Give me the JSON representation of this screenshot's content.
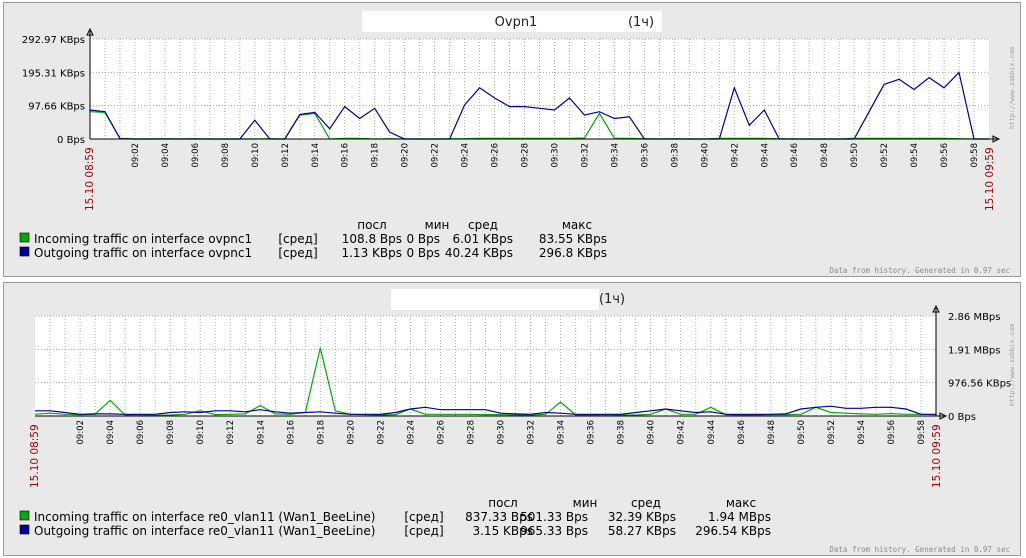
{
  "colors": {
    "incoming": "#00aa00",
    "outgoing": "#000099",
    "edge_label": "#aa0000",
    "grid": "#aaaaaa",
    "panel_bg": "#e9e9e9"
  },
  "time_labels": [
    "09:02",
    "09:04",
    "09:06",
    "09:08",
    "09:10",
    "09:12",
    "09:14",
    "09:16",
    "09:18",
    "09:20",
    "09:22",
    "09:24",
    "09:26",
    "09:28",
    "09:30",
    "09:32",
    "09:34",
    "09:36",
    "09:38",
    "09:40",
    "09:42",
    "09:44",
    "09:46",
    "09:48",
    "09:50",
    "09:52",
    "09:54",
    "09:56",
    "09:58"
  ],
  "start_label": "15.10 08:59",
  "end_label": "15.10 09:59",
  "footer_text": "Data from history. Generated in 0.97 sec",
  "watermark": "http://www.zabbix.com",
  "legend_headers": {
    "last": "посл",
    "min": "мин",
    "avg": "сред",
    "max": "макс"
  },
  "chart_data": [
    {
      "type": "line",
      "title": "Ovpn1",
      "period": "(1ч)",
      "x": [
        "08:59",
        "09:00",
        "09:01",
        "09:02",
        "09:03",
        "09:04",
        "09:05",
        "09:06",
        "09:07",
        "09:08",
        "09:09",
        "09:10",
        "09:11",
        "09:12",
        "09:13",
        "09:14",
        "09:15",
        "09:16",
        "09:17",
        "09:18",
        "09:19",
        "09:20",
        "09:21",
        "09:22",
        "09:23",
        "09:24",
        "09:25",
        "09:26",
        "09:27",
        "09:28",
        "09:29",
        "09:30",
        "09:31",
        "09:32",
        "09:33",
        "09:34",
        "09:35",
        "09:36",
        "09:37",
        "09:38",
        "09:39",
        "09:40",
        "09:41",
        "09:42",
        "09:43",
        "09:44",
        "09:45",
        "09:46",
        "09:47",
        "09:48",
        "09:49",
        "09:50",
        "09:51",
        "09:52",
        "09:53",
        "09:54",
        "09:55",
        "09:56",
        "09:57",
        "09:58",
        "09:59"
      ],
      "y_ticks": [
        "0 Bps",
        "97.66 KBps",
        "195.31 KBps",
        "292.97 KBps"
      ],
      "ylim": [
        0,
        292.97
      ],
      "y_unit": "KBps",
      "y_axis_side": "left",
      "series": [
        {
          "name": "Incoming traffic on interface ovpnc1",
          "values": [
            80,
            78,
            2,
            0,
            0,
            1,
            0,
            1,
            0,
            0,
            0,
            0,
            1,
            0,
            70,
            75,
            0,
            2,
            2,
            0,
            1,
            0,
            0,
            0,
            1,
            1,
            2,
            2,
            2,
            2,
            2,
            2,
            2,
            3,
            75,
            2,
            2,
            1,
            0,
            1,
            0,
            0,
            2,
            2,
            2,
            2,
            1,
            0,
            0,
            0,
            0,
            2,
            2,
            2,
            2,
            2,
            2,
            2,
            1,
            0,
            0
          ],
          "fn": "сред",
          "last": "108.8 Bps",
          "min": "0 Bps",
          "avg": "6.01 KBps",
          "max": "83.55 KBps"
        },
        {
          "name": "Outgoing traffic on interface ovpnc1",
          "values": [
            85,
            80,
            1,
            0,
            0,
            0,
            0,
            0,
            0,
            0,
            0,
            55,
            0,
            0,
            72,
            78,
            30,
            95,
            60,
            90,
            20,
            0,
            0,
            0,
            0,
            100,
            150,
            120,
            95,
            95,
            90,
            85,
            120,
            70,
            80,
            60,
            65,
            0,
            0,
            0,
            0,
            0,
            0,
            150,
            40,
            85,
            0,
            0,
            0,
            0,
            0,
            0,
            80,
            160,
            175,
            145,
            180,
            150,
            195,
            0,
            0
          ],
          "fn": "сред",
          "last": "1.13 KBps",
          "min": "0 Bps",
          "avg": "40.24 KBps",
          "max": "296.8 KBps"
        }
      ]
    },
    {
      "type": "line",
      "title": "",
      "period": "(1ч)",
      "x": [
        "08:59",
        "09:00",
        "09:01",
        "09:02",
        "09:03",
        "09:04",
        "09:05",
        "09:06",
        "09:07",
        "09:08",
        "09:09",
        "09:10",
        "09:11",
        "09:12",
        "09:13",
        "09:14",
        "09:15",
        "09:16",
        "09:17",
        "09:18",
        "09:19",
        "09:20",
        "09:21",
        "09:22",
        "09:23",
        "09:24",
        "09:25",
        "09:26",
        "09:27",
        "09:28",
        "09:29",
        "09:30",
        "09:31",
        "09:32",
        "09:33",
        "09:34",
        "09:35",
        "09:36",
        "09:37",
        "09:38",
        "09:39",
        "09:40",
        "09:41",
        "09:42",
        "09:43",
        "09:44",
        "09:45",
        "09:46",
        "09:47",
        "09:48",
        "09:49",
        "09:50",
        "09:51",
        "09:52",
        "09:53",
        "09:54",
        "09:55",
        "09:56",
        "09:57",
        "09:58",
        "09:59"
      ],
      "y_ticks": [
        "0 Bps",
        "976.56 KBps",
        "1.91 MBps",
        "2.86 MBps"
      ],
      "ylim": [
        0,
        2.86
      ],
      "y_unit": "MBps",
      "y_axis_side": "right",
      "series": [
        {
          "name": "Incoming traffic on interface re0_vlan11 (Wan1_BeeLine)",
          "values": [
            0.05,
            0.08,
            0.05,
            0.04,
            0.05,
            0.45,
            0.03,
            0.04,
            0.02,
            0.03,
            0.05,
            0.15,
            0.04,
            0.05,
            0.06,
            0.3,
            0.06,
            0.05,
            0.1,
            1.95,
            0.15,
            0.05,
            0.04,
            0.03,
            0.04,
            0.2,
            0.05,
            0.05,
            0.05,
            0.05,
            0.04,
            0.04,
            0.03,
            0.03,
            0.05,
            0.4,
            0.03,
            0.03,
            0.04,
            0.03,
            0.03,
            0.05,
            0.2,
            0.05,
            0.05,
            0.25,
            0.04,
            0.03,
            0.03,
            0.04,
            0.04,
            0.05,
            0.25,
            0.1,
            0.08,
            0.06,
            0.05,
            0.07,
            0.05,
            0.05,
            0.04
          ],
          "fn": "сред",
          "last": "837.33 Bps",
          "min": "501.33 Bps",
          "avg": "32.39 KBps",
          "max": "1.94 MBps"
        },
        {
          "name": "Outgoing traffic on interface re0_vlan11 (Wan1_BeeLine)",
          "values": [
            0.15,
            0.15,
            0.1,
            0.05,
            0.06,
            0.06,
            0.05,
            0.05,
            0.05,
            0.1,
            0.12,
            0.1,
            0.15,
            0.15,
            0.12,
            0.18,
            0.12,
            0.08,
            0.1,
            0.12,
            0.08,
            0.05,
            0.05,
            0.05,
            0.1,
            0.2,
            0.25,
            0.18,
            0.18,
            0.18,
            0.18,
            0.08,
            0.06,
            0.05,
            0.1,
            0.08,
            0.05,
            0.05,
            0.05,
            0.05,
            0.1,
            0.15,
            0.2,
            0.15,
            0.1,
            0.12,
            0.05,
            0.05,
            0.05,
            0.05,
            0.06,
            0.2,
            0.25,
            0.28,
            0.22,
            0.22,
            0.25,
            0.25,
            0.2,
            0.05,
            0.05
          ],
          "fn": "сред",
          "last": "3.15 KBps",
          "min": "965.33 Bps",
          "avg": "58.27 KBps",
          "max": "296.54 KBps"
        }
      ]
    }
  ]
}
